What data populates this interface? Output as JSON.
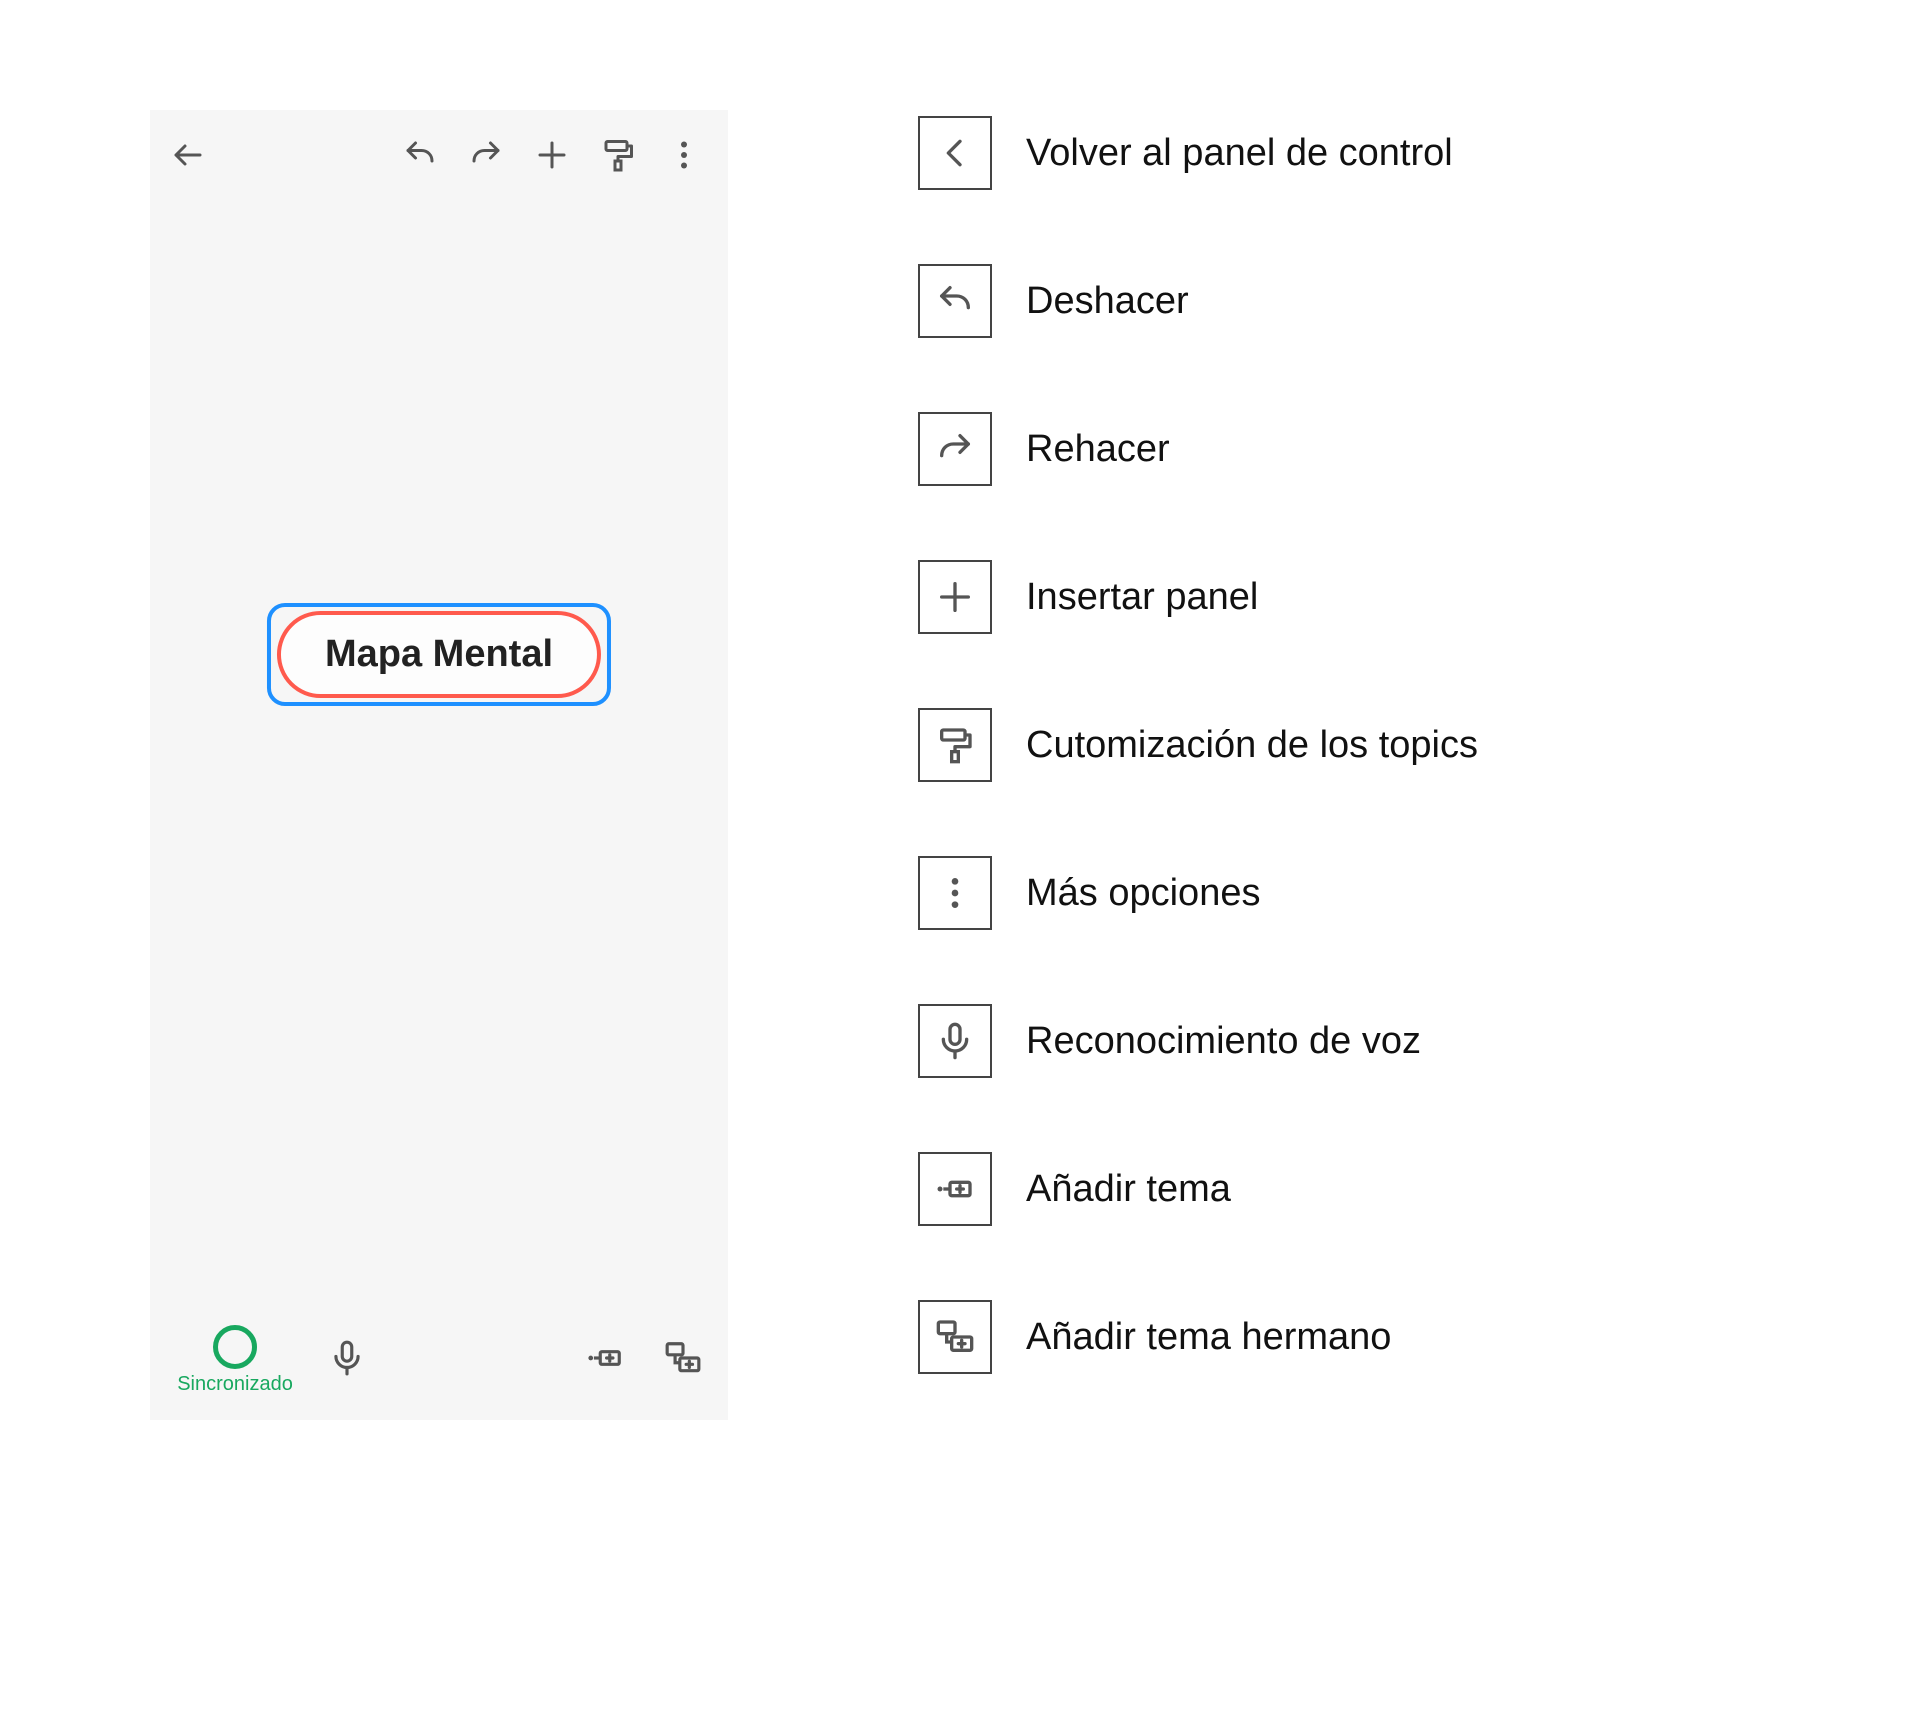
{
  "phone": {
    "central_topic": "Mapa Mental",
    "sync_label": "Sincronizado",
    "status_color": "#18a85f",
    "toolbar_icons": [
      "back-arrow",
      "undo",
      "redo",
      "plus",
      "paint-roller",
      "more-vertical"
    ],
    "bottom_icons": [
      "microphone",
      "add-topic",
      "add-sibling-topic"
    ]
  },
  "legend": {
    "items": [
      {
        "icon": "chevron-left",
        "label": "Volver al panel de control"
      },
      {
        "icon": "undo",
        "label": "Deshacer"
      },
      {
        "icon": "redo",
        "label": "Rehacer"
      },
      {
        "icon": "plus",
        "label": "Insertar panel"
      },
      {
        "icon": "paint-roller",
        "label": "Cutomización de los topics"
      },
      {
        "icon": "more-vertical",
        "label": "Más opciones"
      },
      {
        "icon": "microphone",
        "label": "Reconocimiento de voz"
      },
      {
        "icon": "add-topic",
        "label": "Añadir tema"
      },
      {
        "icon": "add-sibling-topic",
        "label": "Añadir tema hermano"
      }
    ]
  },
  "colors": {
    "selection_border": "#1e90ff",
    "topic_border": "#ff5a4d"
  }
}
